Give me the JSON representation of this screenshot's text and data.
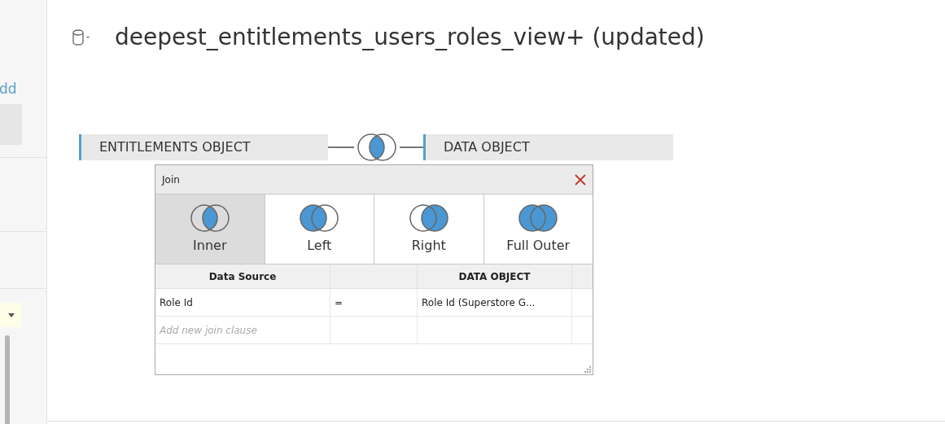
{
  "sidebar": {
    "link": "dd"
  },
  "title": "deepest_entitlements_users_roles_view+ (updated)",
  "join_bar": {
    "left": "ENTITLEMENTS OBJECT",
    "right": "DATA OBJECT",
    "kind": "inner"
  },
  "join_dialog": {
    "title": "Join",
    "join_types": [
      {
        "label": "Inner",
        "kind": "inner",
        "selected": true
      },
      {
        "label": "Left",
        "kind": "left",
        "selected": false
      },
      {
        "label": "Right",
        "kind": "right",
        "selected": false
      },
      {
        "label": "Full Outer",
        "kind": "full",
        "selected": false
      }
    ],
    "columns": [
      "Data Source",
      "",
      "DATA OBJECT"
    ],
    "clauses": [
      {
        "left": "Role Id",
        "operator": "=",
        "right": "Role Id (Superstore G..."
      }
    ],
    "add_placeholder": "Add new join clause"
  }
}
